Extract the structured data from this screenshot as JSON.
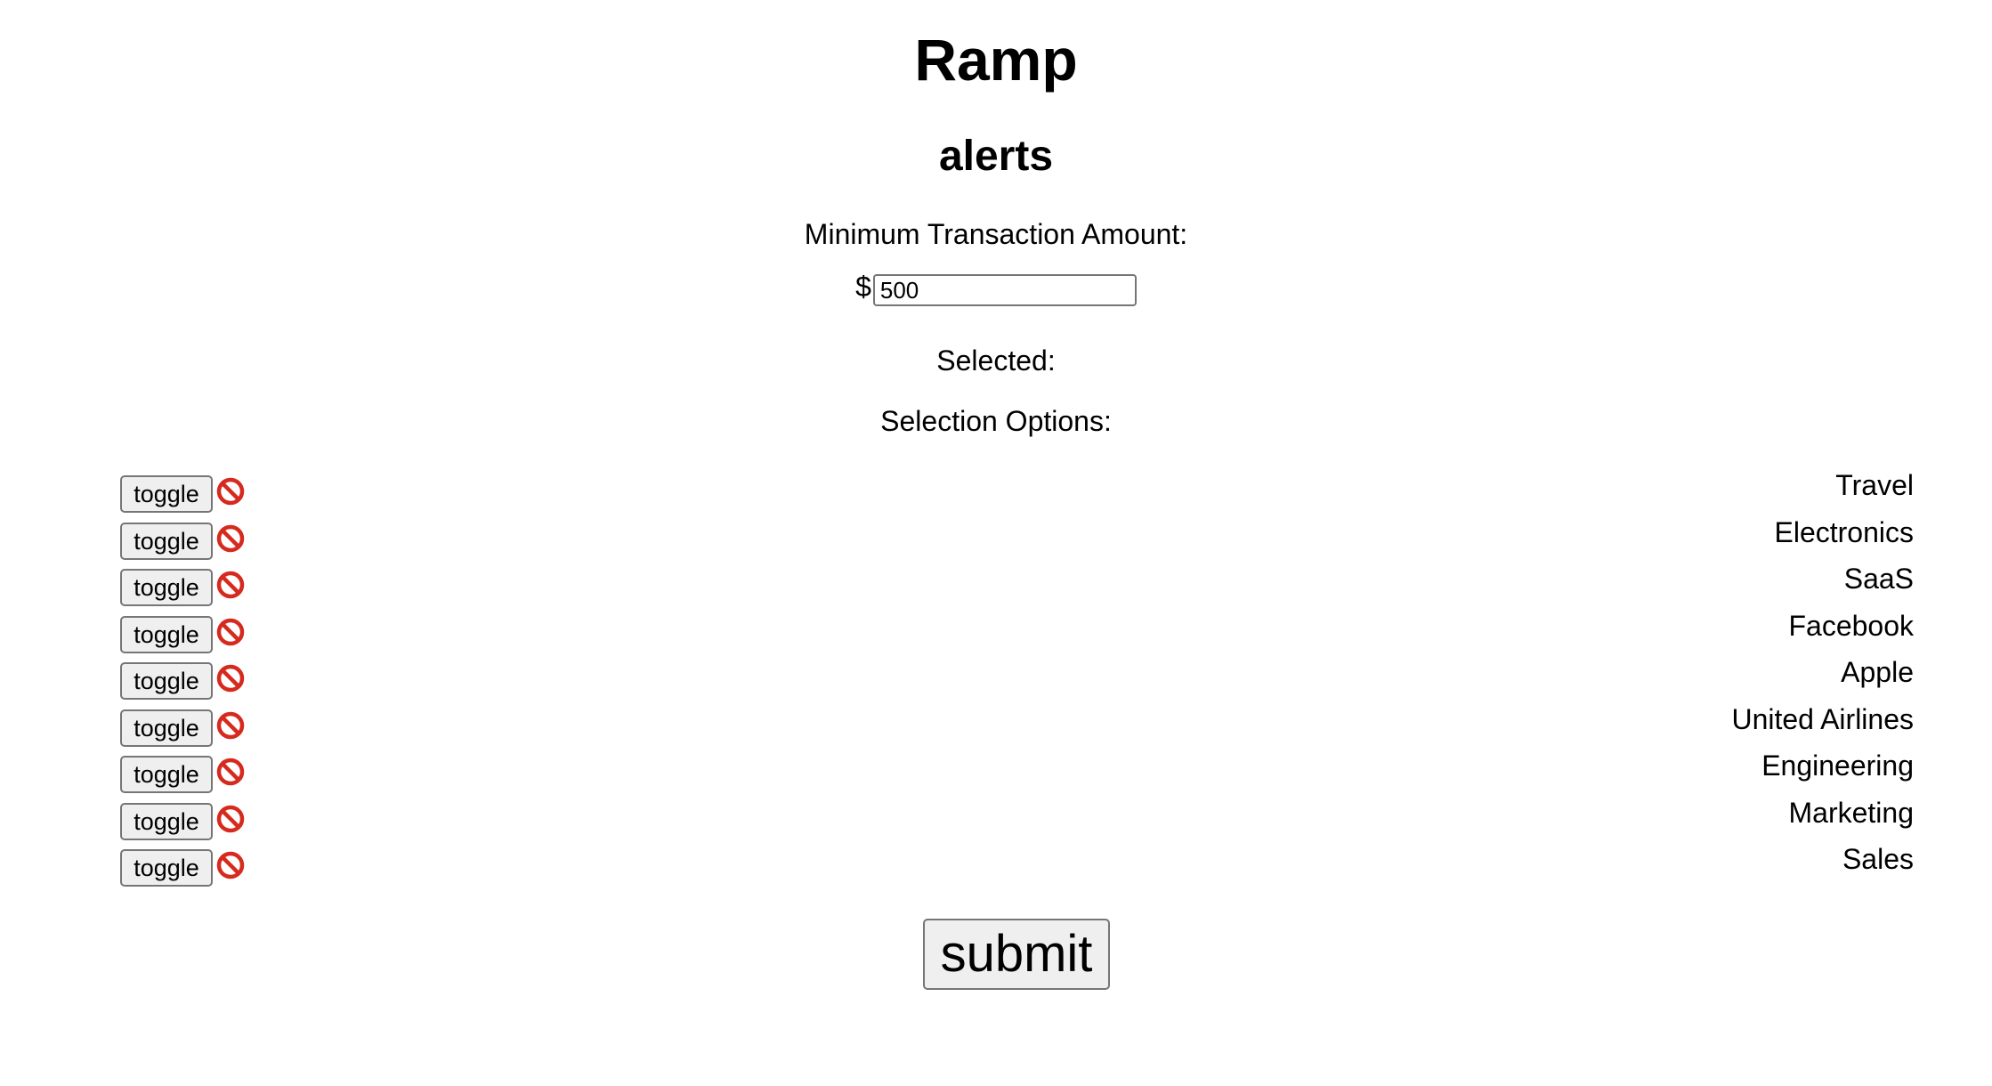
{
  "header": {
    "title": "Ramp",
    "subtitle": "alerts"
  },
  "form": {
    "min_amount_label": "Minimum Transaction Amount:",
    "currency_symbol": "$",
    "min_amount_value": "500",
    "selected_label": "Selected:",
    "options_label": "Selection Options:",
    "toggle_label": "toggle",
    "toggle_icon": "prohibited-icon",
    "submit_label": "submit"
  },
  "options": [
    {
      "label": "Travel"
    },
    {
      "label": "Electronics"
    },
    {
      "label": "SaaS"
    },
    {
      "label": "Facebook"
    },
    {
      "label": "Apple"
    },
    {
      "label": "United Airlines"
    },
    {
      "label": "Engineering"
    },
    {
      "label": "Marketing"
    },
    {
      "label": "Sales"
    }
  ],
  "colors": {
    "prohibited_icon": "#d62a1e",
    "button_bg": "#efefef",
    "button_border": "#767676"
  }
}
